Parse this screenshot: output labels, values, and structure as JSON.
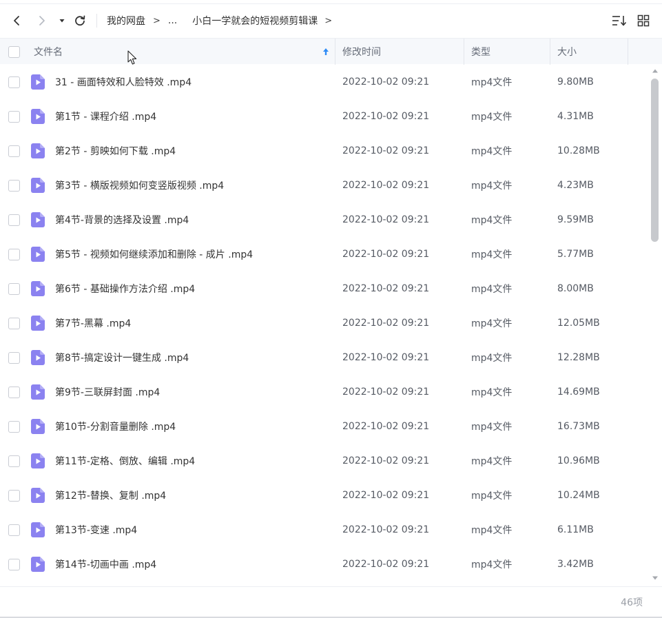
{
  "toolbar": {
    "breadcrumb": {
      "root": "我的网盘",
      "separator": ">",
      "ellipsis": "...",
      "current": "小白一学就会的短视频剪辑课"
    }
  },
  "table": {
    "headers": {
      "name": "文件名",
      "modified": "修改时间",
      "type": "类型",
      "size": "大小"
    },
    "rows": [
      {
        "name": "31 - 画面特效和人脸特效 .mp4",
        "modified": "2022-10-02 09:21",
        "type": "mp4文件",
        "size": "9.80MB"
      },
      {
        "name": "第1节 - 课程介绍 .mp4",
        "modified": "2022-10-02 09:21",
        "type": "mp4文件",
        "size": "4.31MB"
      },
      {
        "name": "第2节 - 剪映如何下载 .mp4",
        "modified": "2022-10-02 09:21",
        "type": "mp4文件",
        "size": "10.28MB"
      },
      {
        "name": "第3节 - 横版视频如何变竖版视频 .mp4",
        "modified": "2022-10-02 09:21",
        "type": "mp4文件",
        "size": "4.23MB"
      },
      {
        "name": "第4节-背景的选择及设置 .mp4",
        "modified": "2022-10-02 09:21",
        "type": "mp4文件",
        "size": "9.59MB"
      },
      {
        "name": "第5节 - 视频如何继续添加和删除 - 成片 .mp4",
        "modified": "2022-10-02 09:21",
        "type": "mp4文件",
        "size": "5.77MB"
      },
      {
        "name": "第6节 - 基础操作方法介绍 .mp4",
        "modified": "2022-10-02 09:21",
        "type": "mp4文件",
        "size": "8.00MB"
      },
      {
        "name": "第7节-黑幕 .mp4",
        "modified": "2022-10-02 09:21",
        "type": "mp4文件",
        "size": "12.05MB"
      },
      {
        "name": "第8节-搞定设计一键生成 .mp4",
        "modified": "2022-10-02 09:21",
        "type": "mp4文件",
        "size": "12.28MB"
      },
      {
        "name": "第9节-三联屏封面 .mp4",
        "modified": "2022-10-02 09:21",
        "type": "mp4文件",
        "size": "14.69MB"
      },
      {
        "name": "第10节-分割音量删除 .mp4",
        "modified": "2022-10-02 09:21",
        "type": "mp4文件",
        "size": "16.73MB"
      },
      {
        "name": "第11节-定格、倒放、编辑 .mp4",
        "modified": "2022-10-02 09:21",
        "type": "mp4文件",
        "size": "10.96MB"
      },
      {
        "name": "第12节-替换、复制 .mp4",
        "modified": "2022-10-02 09:21",
        "type": "mp4文件",
        "size": "10.24MB"
      },
      {
        "name": "第13节-变速 .mp4",
        "modified": "2022-10-02 09:21",
        "type": "mp4文件",
        "size": "6.11MB"
      },
      {
        "name": "第14节-切画中画 .mp4",
        "modified": "2022-10-02 09:21",
        "type": "mp4文件",
        "size": "3.42MB"
      }
    ]
  },
  "footer": {
    "item_count": "46项"
  },
  "icons": {
    "back": "chevron-left-icon",
    "forward": "chevron-right-icon",
    "dropdown": "caret-down-icon",
    "refresh": "refresh-icon",
    "sort": "sort-list-icon",
    "grid": "grid-view-icon",
    "sort_direction": "arrow-up-icon",
    "file": "video-file-icon"
  },
  "colors": {
    "accent": "#2f8cf6",
    "file_icon": "#8b82f0",
    "header_bg": "#f6f8fb",
    "scroll_thumb": "#c7c9cd"
  }
}
